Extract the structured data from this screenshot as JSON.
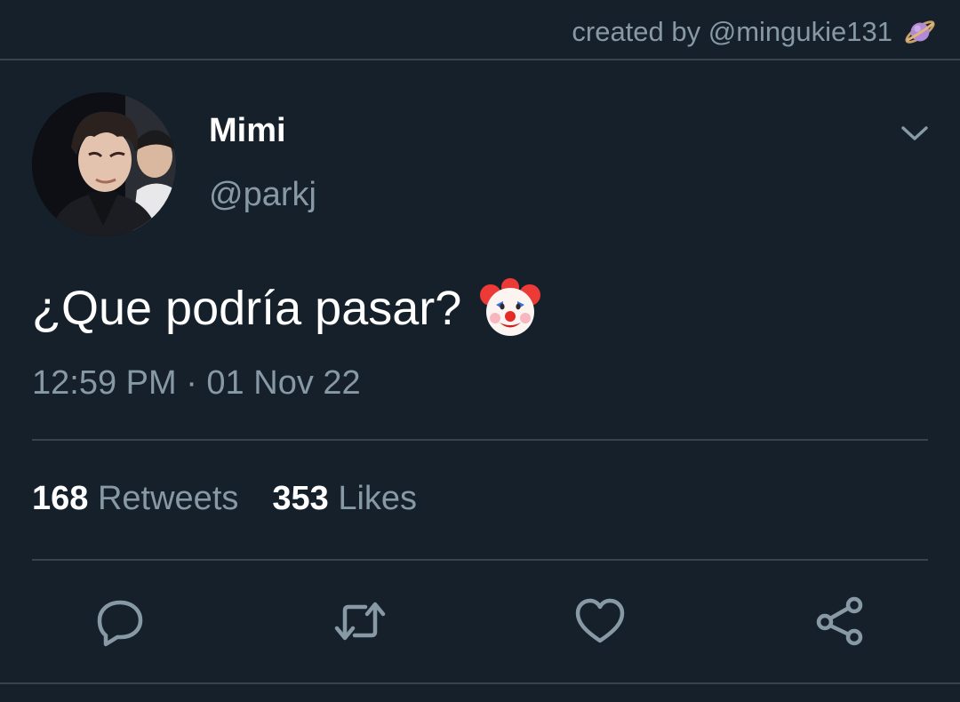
{
  "header": {
    "credit": "created by @mingukie131",
    "credit_icon": "ringed-planet-icon"
  },
  "tweet": {
    "display_name": "Mimi",
    "handle": "@parkj",
    "text": "¿Que podría pasar?",
    "emoji": "clown-face-icon",
    "timestamp": "12:59 PM · 01 Nov 22",
    "retweets_count": "168",
    "retweets_label": "Retweets",
    "likes_count": "353",
    "likes_label": "Likes"
  },
  "actions": [
    "reply-icon",
    "retweet-icon",
    "like-icon",
    "share-icon"
  ],
  "colors": {
    "background": "#15202b",
    "divider": "#38444d",
    "secondary_text": "#8899a6",
    "primary_text": "#ffffff"
  }
}
